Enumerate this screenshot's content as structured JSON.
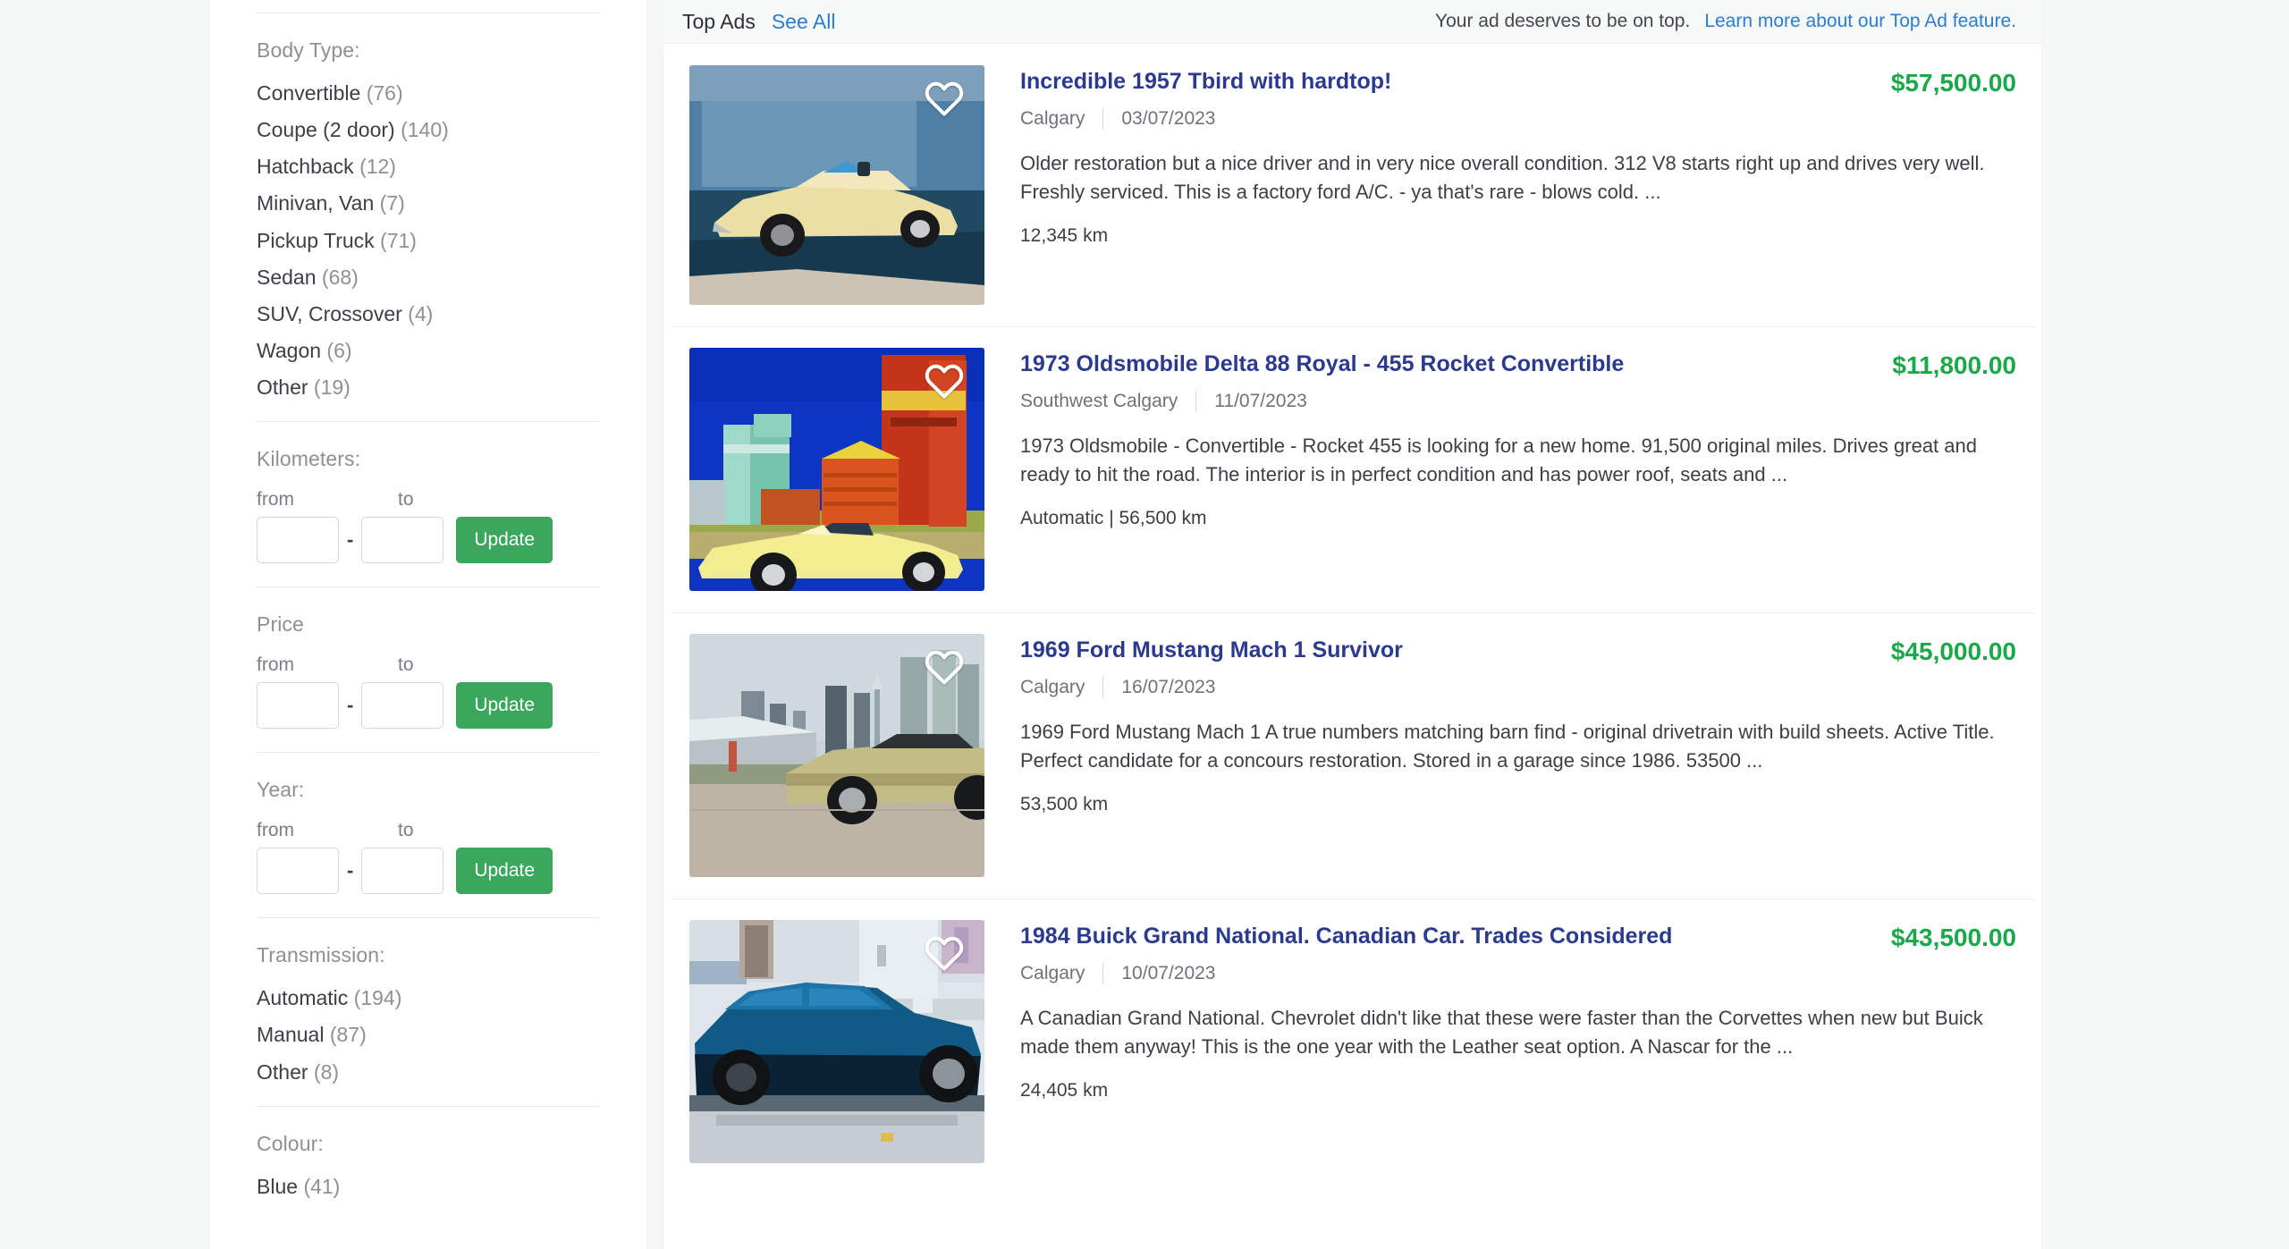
{
  "sidebar": {
    "sections": [
      {
        "id": "body-type",
        "heading": "Body Type:",
        "options": [
          {
            "label": "Convertible",
            "count": "(76)"
          },
          {
            "label": "Coupe (2 door)",
            "count": "(140)"
          },
          {
            "label": "Hatchback",
            "count": "(12)"
          },
          {
            "label": "Minivan, Van",
            "count": "(7)"
          },
          {
            "label": "Pickup Truck",
            "count": "(71)"
          },
          {
            "label": "Sedan",
            "count": "(68)"
          },
          {
            "label": "SUV, Crossover",
            "count": "(4)"
          },
          {
            "label": "Wagon",
            "count": "(6)"
          },
          {
            "label": "Other",
            "count": "(19)"
          }
        ]
      },
      {
        "id": "kilometers",
        "heading": "Kilometers:",
        "from_label": "from",
        "to_label": "to",
        "from_value": "",
        "to_value": "",
        "dash": "-",
        "update_label": "Update"
      },
      {
        "id": "price",
        "heading": "Price",
        "from_label": "from",
        "to_label": "to",
        "from_value": "",
        "to_value": "",
        "dash": "-",
        "update_label": "Update"
      },
      {
        "id": "year",
        "heading": "Year:",
        "from_label": "from",
        "to_label": "to",
        "from_value": "",
        "to_value": "",
        "dash": "-",
        "update_label": "Update"
      },
      {
        "id": "transmission",
        "heading": "Transmission:",
        "options": [
          {
            "label": "Automatic",
            "count": "(194)"
          },
          {
            "label": "Manual",
            "count": "(87)"
          },
          {
            "label": "Other",
            "count": "(8)"
          }
        ]
      },
      {
        "id": "colour",
        "heading": "Colour:",
        "options": [
          {
            "label": "Blue",
            "count": "(41)"
          }
        ]
      }
    ]
  },
  "topads": {
    "title": "Top Ads",
    "see_all": "See All",
    "note": "Your ad deserves to be on top.",
    "learn_more": "Learn more about our Top Ad feature."
  },
  "listings": [
    {
      "title": "Incredible 1957 Tbird with hardtop!",
      "price": "$57,500.00",
      "location": "Calgary",
      "date": "03/07/2023",
      "description": "Older restoration but a nice driver and in very nice overall condition. 312 V8 starts right up and drives very well. Freshly serviced. This is a factory ford A/C. - ya that's rare - blows cold. ...",
      "specs": "12,345 km",
      "favorite_icon": "heart-icon"
    },
    {
      "title": "1973 Oldsmobile Delta 88 Royal - 455 Rocket Convertible",
      "price": "$11,800.00",
      "location": "Southwest Calgary",
      "date": "11/07/2023",
      "description": "1973 Oldsmobile - Convertible - Rocket 455 is looking for a new home. 91,500 original miles. Drives great and ready to hit the road. The interior is in perfect condition and has power roof, seats and ...",
      "specs": "Automatic | 56,500 km",
      "favorite_icon": "heart-icon"
    },
    {
      "title": "1969 Ford Mustang Mach 1 Survivor",
      "price": "$45,000.00",
      "location": "Calgary",
      "date": "16/07/2023",
      "description": "1969 Ford Mustang Mach 1 A true numbers matching barn find - original drivetrain with build sheets. Active Title. Perfect candidate for a concours restoration. Stored in a garage since 1986. 53500 ...",
      "specs": "53,500 km",
      "favorite_icon": "heart-icon"
    },
    {
      "title": "1984 Buick Grand National. Canadian Car. Trades Considered",
      "price": "$43,500.00",
      "location": "Calgary",
      "date": "10/07/2023",
      "description": "A Canadian Grand National. Chevrolet didn't like that these were faster than the Corvettes when new but Buick made them anyway! This is the one year with the Leather seat option. A Nascar for the ...",
      "specs": "24,405 km",
      "favorite_icon": "heart-icon"
    }
  ],
  "colors": {
    "price_green": "#1aa84a",
    "title_navy": "#2b3a8f",
    "link_blue": "#2b7cd3",
    "update_button_green": "#3aa75c",
    "page_background": "#f5f6f6"
  }
}
